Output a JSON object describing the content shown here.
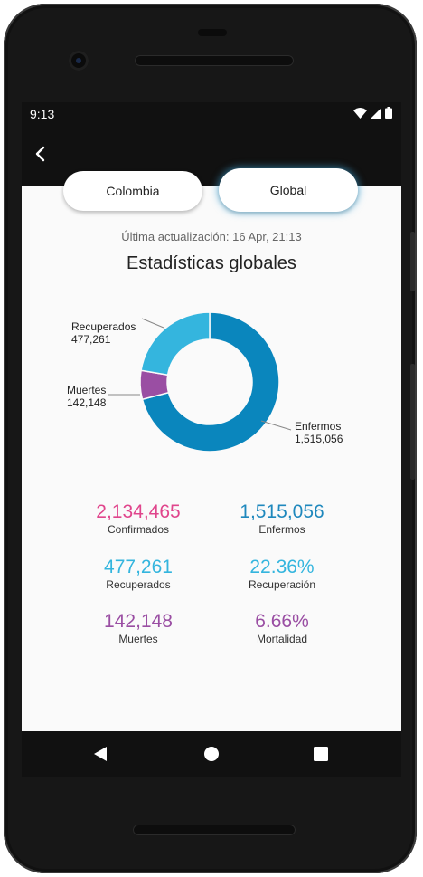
{
  "status_bar": {
    "time": "9:13"
  },
  "tabs": {
    "colombia": "Colombia",
    "global": "Global",
    "selected": "Global"
  },
  "last_update": "Última actualización: 16 Apr, 21:13",
  "page_title": "Estadísticas globales",
  "chart_data": {
    "type": "pie",
    "slices": [
      {
        "name": "Enfermos",
        "value": 1515056,
        "label": "1,515,056",
        "color": "#0a86bd"
      },
      {
        "name": "Muertes",
        "value": 142148,
        "label": "142,148",
        "color": "#9a4ea3"
      },
      {
        "name": "Recuperados",
        "value": 477261,
        "label": "477,261",
        "color": "#34b5de"
      }
    ]
  },
  "stats": {
    "confirmed": {
      "value": "2,134,465",
      "label": "Confirmados",
      "color": "#e0458c"
    },
    "sick": {
      "value": "1,515,056",
      "label": "Enfermos",
      "color": "#1f88bd"
    },
    "recovered": {
      "value": "477,261",
      "label": "Recuperados",
      "color": "#34b5de"
    },
    "recovery_rate": {
      "value": "22.36%",
      "label": "Recuperación",
      "color": "#34b5de"
    },
    "deaths": {
      "value": "142,148",
      "label": "Muertes",
      "color": "#9a4ea3"
    },
    "mortality": {
      "value": "6.66%",
      "label": "Mortalidad",
      "color": "#9a4ea3"
    }
  }
}
